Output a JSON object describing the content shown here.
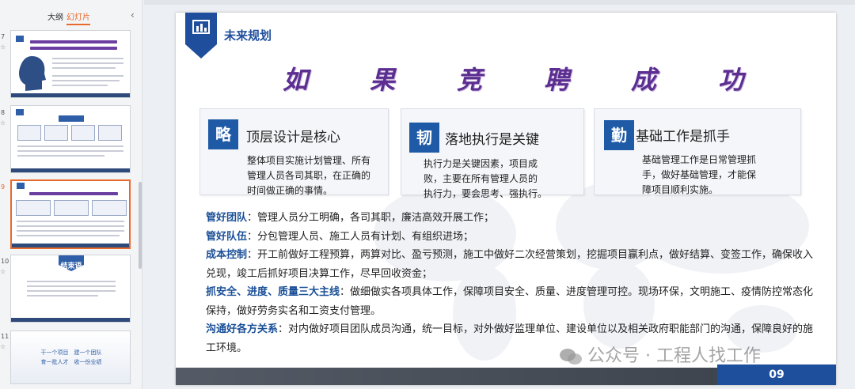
{
  "panel": {
    "tab_outline": "大纲",
    "tab_slides": "幻灯片",
    "collapse_icon": "chevron-left-icon",
    "slides": [
      {
        "num": "7",
        "star": "☆",
        "heading": "",
        "text": ""
      },
      {
        "num": "8",
        "star": "☆",
        "heading": "",
        "text": ""
      },
      {
        "num": "9",
        "star": "☆",
        "heading": "",
        "text": ""
      },
      {
        "num": "10",
        "star": "☆",
        "heading": "结束语",
        "text": ""
      },
      {
        "num": "11",
        "star": "☆",
        "line1": "干一个项目　建一个团队",
        "line2": "育一批人才　收一份业绩"
      }
    ]
  },
  "slide": {
    "title": "未来规划",
    "big_chars": [
      "如",
      "果",
      "竞",
      "聘",
      "成",
      "功"
    ],
    "cards": [
      {
        "icon": "略",
        "heading": "顶层设计是核心",
        "body": [
          "整体项目实施计划管理、所有",
          "管理人员各司其职，在正确的",
          "时间做正确的事情。"
        ]
      },
      {
        "icon": "韧",
        "heading": "落地执行是关键",
        "body": [
          "执行力是关键因素，项目成",
          "败，主要在所有管理人员的",
          "执行力，要会思考、强执行。"
        ]
      },
      {
        "icon": "勤",
        "heading": "基础工作是抓手",
        "body": [
          "基础管理工作是日常管理抓",
          "手，做好基础管理，才能保",
          "障项目顺利实施。"
        ]
      }
    ],
    "details": [
      {
        "key": "管好团队",
        "text": "：管理人员分工明确，各司其职，廉洁高效开展工作；"
      },
      {
        "key": "管好队伍",
        "text": "：分包管理人员、施工人员有计划、有组织进场；"
      },
      {
        "key": "成本控制",
        "text": "：开工前做好工程预算，两算对比、盈亏预测，施工中做好二次经营策划，挖掘项目赢利点，做好结算、变签工作，确保收入兑现，竣工后抓好项目决算工作，尽早回收资金；"
      },
      {
        "key": "抓安全、进度、质量三大主线",
        "text": "：做细做实各项具体工作，保障项目安全、质量、进度管理可控。现场环保，文明施工、疫情防控常态化保持，做好劳务实名和工资支付管理。"
      },
      {
        "key": "沟通好各方关系",
        "text": "：对内做好项目团队成员沟通，统一目标，对外做好监理单位、建设单位以及相关政府职能部门的沟通，保障良好的施工环境。"
      }
    ],
    "page_number": "09"
  },
  "watermark": "公众号 · 工程人找工作",
  "colors": {
    "accent": "#1f5aa6",
    "purple": "#5c2e91",
    "tab_active": "#e8692c"
  }
}
